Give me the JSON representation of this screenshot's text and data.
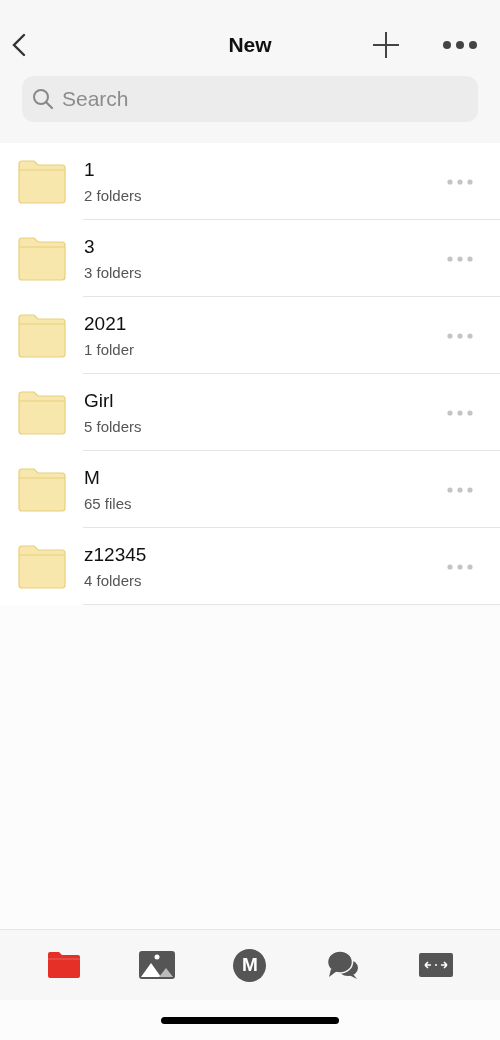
{
  "header": {
    "title": "New"
  },
  "search": {
    "placeholder": "Search"
  },
  "items": [
    {
      "name": "1",
      "detail": "2 folders"
    },
    {
      "name": "3",
      "detail": "3 folders"
    },
    {
      "name": "2021",
      "detail": "1 folder"
    },
    {
      "name": "Girl",
      "detail": "5 folders"
    },
    {
      "name": "M",
      "detail": "65 files"
    },
    {
      "name": "z12345",
      "detail": "4 folders"
    }
  ],
  "tabs": [
    {
      "kind": "files",
      "selected": true
    },
    {
      "kind": "photos",
      "selected": false
    },
    {
      "kind": "home",
      "selected": false,
      "letter": "M"
    },
    {
      "kind": "chat",
      "selected": false
    },
    {
      "kind": "transfer",
      "selected": false
    }
  ]
}
